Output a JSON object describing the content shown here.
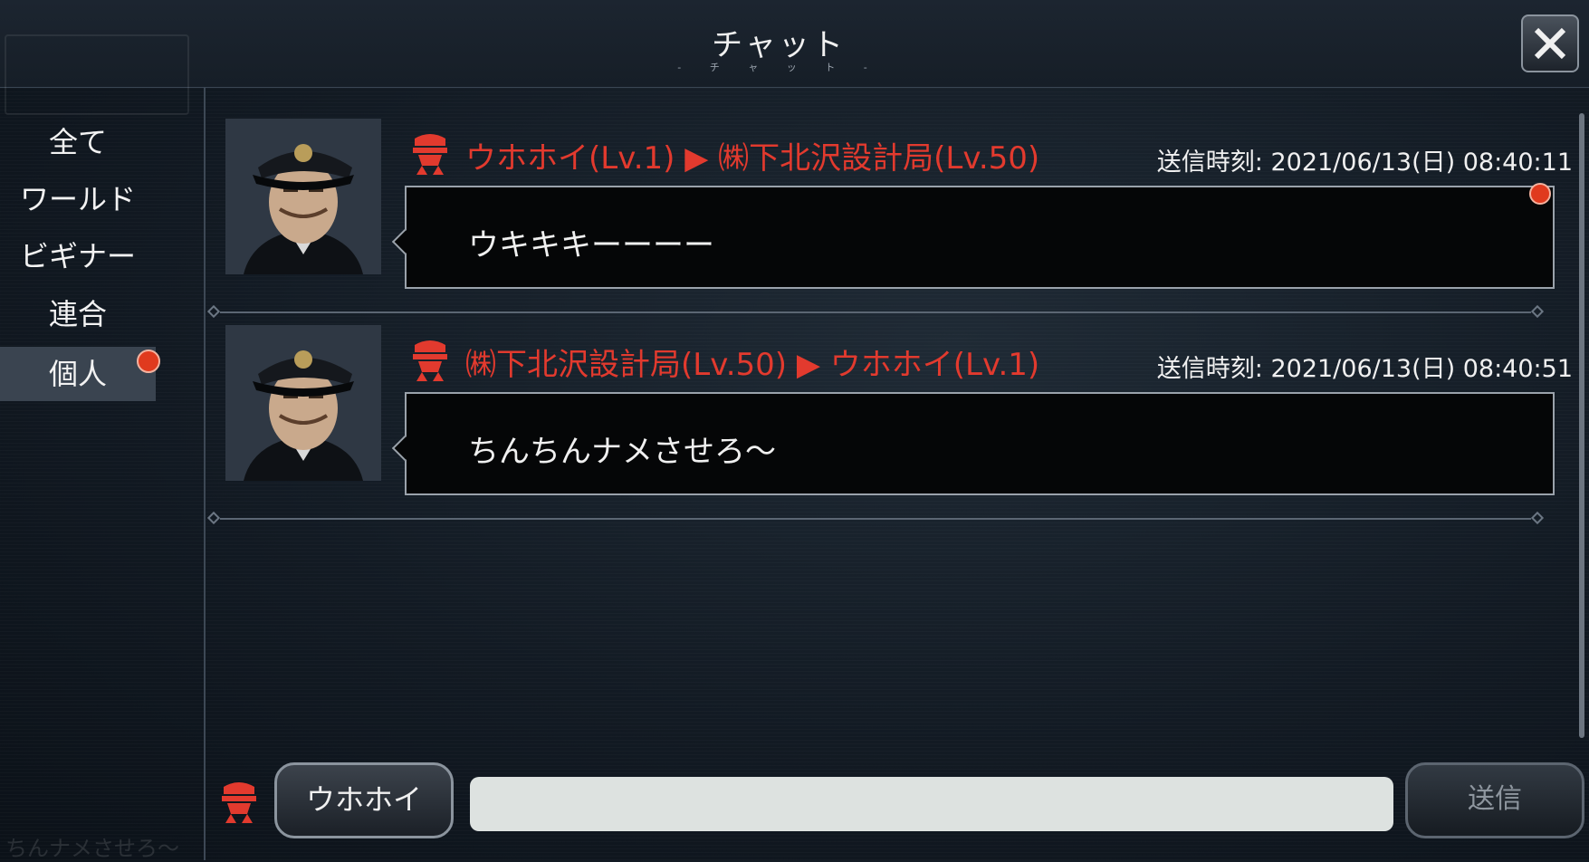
{
  "header": {
    "title": "チャット",
    "subtitle": "- チ ャ ッ ト -"
  },
  "sidebar": {
    "tabs": [
      {
        "label": "全て",
        "active": false,
        "badge": false
      },
      {
        "label": "ワールド",
        "active": false,
        "badge": false
      },
      {
        "label": "ビギナー",
        "active": false,
        "badge": false
      },
      {
        "label": "連合",
        "active": false,
        "badge": false
      },
      {
        "label": "個人",
        "active": true,
        "badge": true
      }
    ],
    "footer_text": "ちんナメさせろ〜"
  },
  "messages": [
    {
      "header": "ウホホイ(Lv.1) ▶ ㈱下北沢設計局(Lv.50)",
      "time": "送信時刻: 2021/06/13(日) 08:40:11",
      "text": "ウキキキーーーー",
      "unread": true
    },
    {
      "header": "㈱下北沢設計局(Lv.50) ▶ ウホホイ(Lv.1)",
      "time": "送信時刻: 2021/06/13(日) 08:40:51",
      "text": "ちんちんナメさせろ〜",
      "unread": false
    }
  ],
  "input_bar": {
    "name_button": "ウホホイ",
    "input_value": "",
    "send_button": "送信"
  },
  "colors": {
    "accent_red": "#e23a2e",
    "badge_red": "#e03a1e",
    "background": "#121a23"
  },
  "icons": [
    "close-icon",
    "rank-cap-icon",
    "avatar-officer"
  ]
}
